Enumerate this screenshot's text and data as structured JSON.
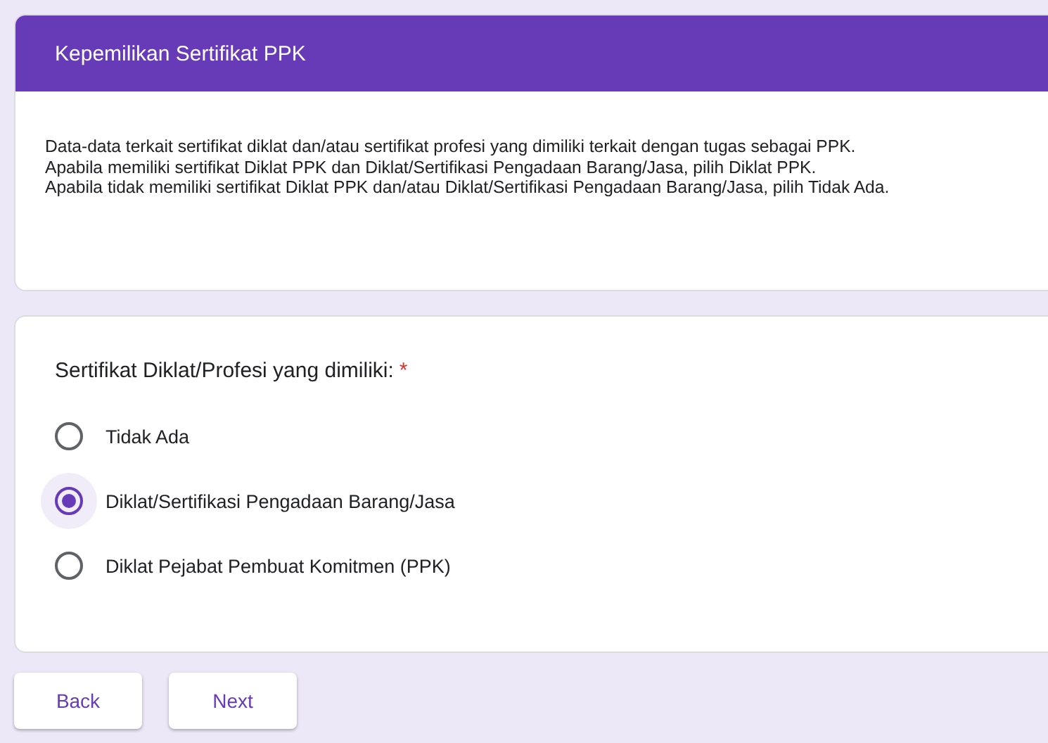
{
  "section": {
    "title": "Kepemilikan Sertifikat PPK",
    "description": [
      "Data-data terkait sertifikat diklat dan/atau sertifikat profesi yang dimiliki terkait dengan tugas sebagai PPK.",
      "Apabila memiliki sertifikat Diklat PPK dan Diklat/Sertifikasi Pengadaan Barang/Jasa, pilih Diklat PPK.",
      "Apabila tidak memiliki sertifikat Diklat PPK dan/atau Diklat/Sertifikasi Pengadaan Barang/Jasa, pilih Tidak Ada."
    ]
  },
  "question": {
    "label": "Sertifikat Diklat/Profesi yang dimiliki:",
    "required_mark": "*",
    "options": [
      {
        "label": "Tidak Ada",
        "selected": false
      },
      {
        "label": "Diklat/Sertifikasi Pengadaan Barang/Jasa",
        "selected": true
      },
      {
        "label": "Diklat Pejabat Pembuat Komitmen (PPK)",
        "selected": false
      }
    ]
  },
  "buttons": [
    "Back",
    "Next"
  ]
}
